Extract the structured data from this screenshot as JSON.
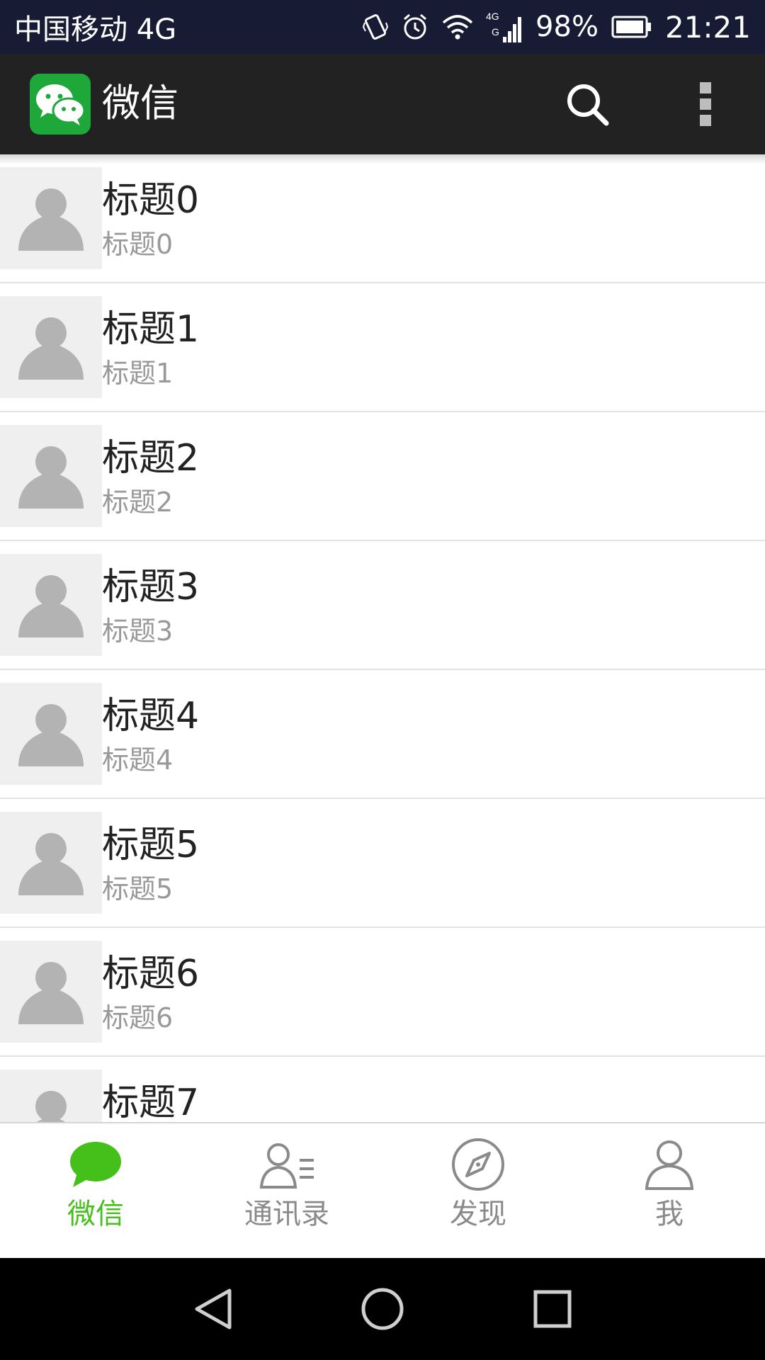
{
  "status_bar": {
    "carrier": "中国移动 4G",
    "battery_percent": "98%",
    "time": "21:21",
    "icons": [
      "vibrate-icon",
      "alarm-icon",
      "wifi-icon",
      "signal-4g-icon",
      "battery-icon"
    ]
  },
  "action_bar": {
    "title": "微信",
    "logo_icon": "wechat-logo-icon",
    "search_icon": "search-icon",
    "overflow_icon": "overflow-menu-icon",
    "background": "#222222"
  },
  "list": {
    "items": [
      {
        "title": "标题0",
        "subtitle": "标题0"
      },
      {
        "title": "标题1",
        "subtitle": "标题1"
      },
      {
        "title": "标题2",
        "subtitle": "标题2"
      },
      {
        "title": "标题3",
        "subtitle": "标题3"
      },
      {
        "title": "标题4",
        "subtitle": "标题4"
      },
      {
        "title": "标题5",
        "subtitle": "标题5"
      },
      {
        "title": "标题6",
        "subtitle": "标题6"
      },
      {
        "title": "标题7",
        "subtitle": ""
      }
    ]
  },
  "tab_bar": {
    "active_color": "#45c01a",
    "inactive_color": "#8a8a8a",
    "tabs": [
      {
        "label": "微信",
        "icon": "chat-bubble-icon",
        "active": true
      },
      {
        "label": "通讯录",
        "icon": "contacts-icon",
        "active": false
      },
      {
        "label": "发现",
        "icon": "compass-icon",
        "active": false
      },
      {
        "label": "我",
        "icon": "person-icon",
        "active": false
      }
    ]
  },
  "nav_bar": {
    "buttons": [
      "back-icon",
      "home-icon",
      "recents-icon"
    ]
  }
}
